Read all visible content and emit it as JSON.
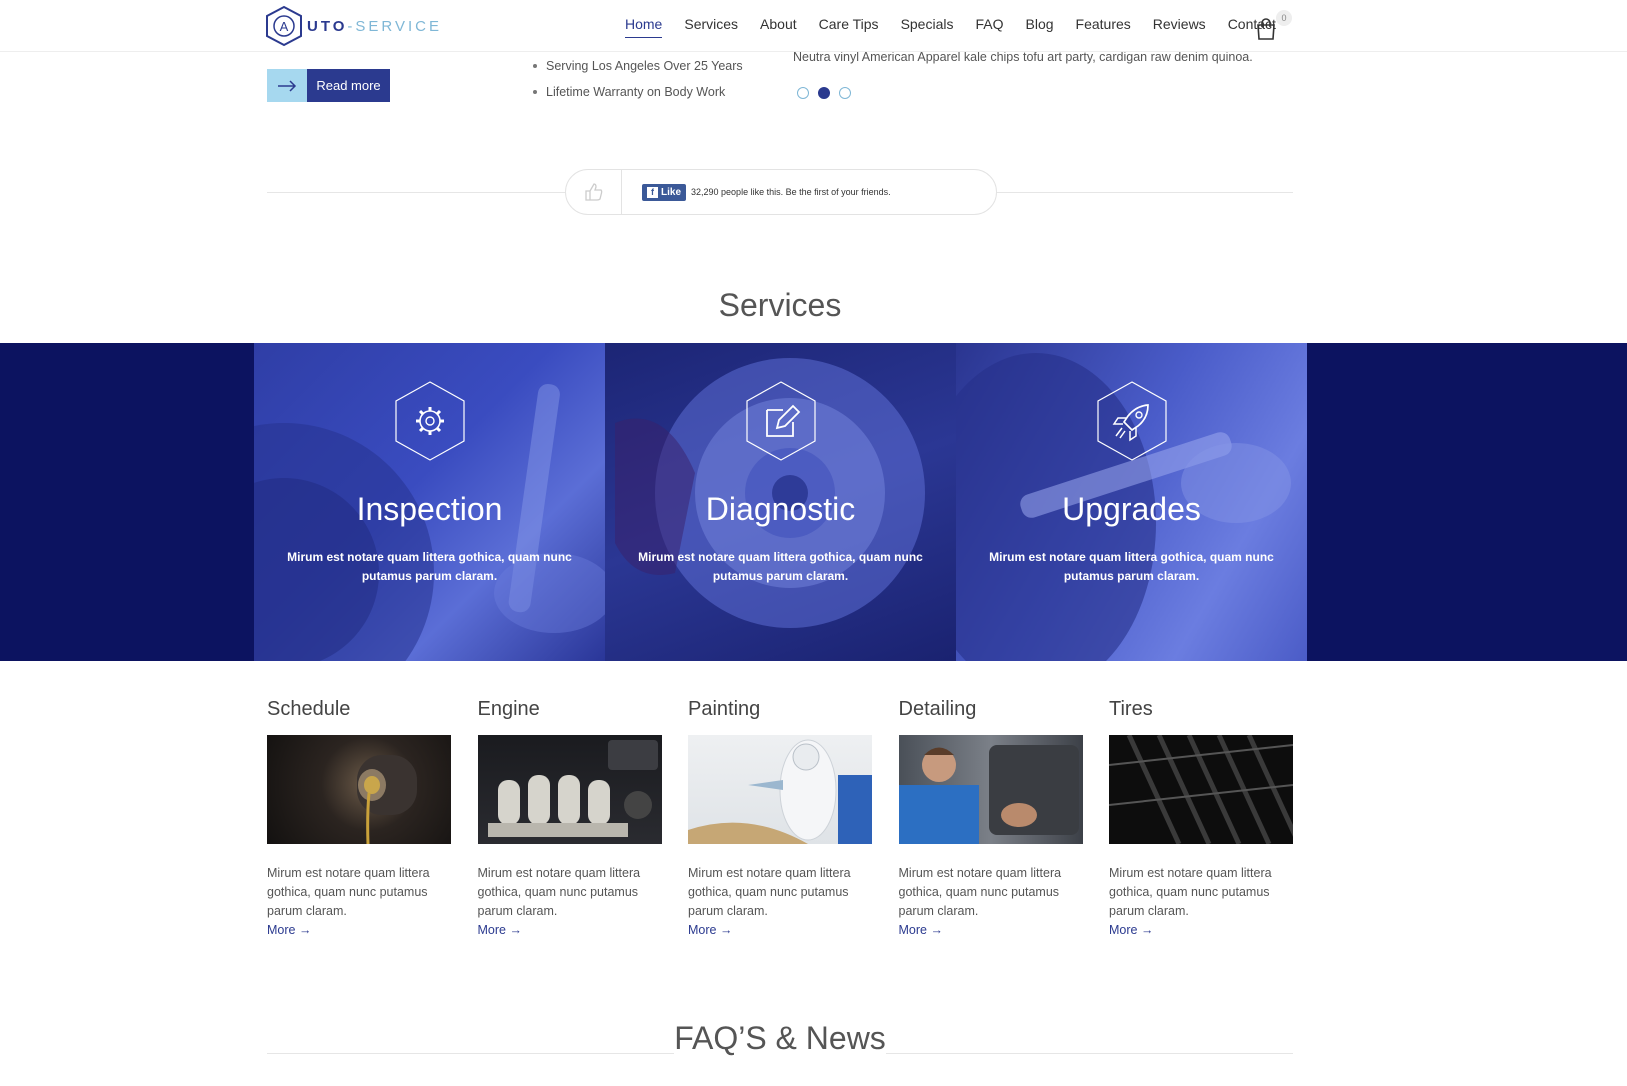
{
  "header": {
    "logo_letter": "A",
    "logo_word_a": "UTO",
    "logo_word_b": "-SERVICE",
    "nav": [
      "Home",
      "Services",
      "About",
      "Care Tips",
      "Specials",
      "FAQ",
      "Blog",
      "Features",
      "Reviews",
      "Contact"
    ],
    "active_nav": "Home",
    "cart_count": "0"
  },
  "intro": {
    "read_more": "Read more",
    "bullets": [
      "Serving Los Angeles Over 25 Years",
      "Lifetime Warranty on Body Work"
    ],
    "tagline": "Neutra vinyl American Apparel kale chips tofu art party, cardigan raw denim quinoa.",
    "slider_active_dot": 2
  },
  "facebook": {
    "like_label": "Like",
    "text": "32,290 people like this. Be the first of your friends."
  },
  "services": {
    "title": "Services",
    "panels": [
      {
        "title": "Inspection",
        "text": "Mirum est notare quam littera gothica, quam nunc putamus parum claram.",
        "icon": "gear-icon"
      },
      {
        "title": "Diagnostic",
        "text": "Mirum est notare quam littera gothica, quam nunc putamus parum claram.",
        "icon": "edit-icon"
      },
      {
        "title": "Upgrades",
        "text": "Mirum est notare quam littera gothica, quam nunc putamus parum claram.",
        "icon": "rocket-icon"
      }
    ]
  },
  "cards": [
    {
      "title": "Schedule",
      "text": "Mirum est notare quam littera gothica, quam nunc putamus parum claram.",
      "more": "More →"
    },
    {
      "title": "Engine",
      "text": "Mirum est notare quam littera gothica, quam nunc putamus parum claram.",
      "more": "More →"
    },
    {
      "title": "Painting",
      "text": "Mirum est notare quam littera gothica, quam nunc putamus parum claram.",
      "more": "More →"
    },
    {
      "title": "Detailing",
      "text": "Mirum est notare quam littera gothica, quam nunc putamus parum claram.",
      "more": "More →"
    },
    {
      "title": "Tires",
      "text": "Mirum est notare quam littera gothica, quam nunc putamus parum claram.",
      "more": "More →"
    }
  ],
  "faq": {
    "title": "FAQ’S & News"
  },
  "colors": {
    "brand": "#2b3a8f",
    "accent": "#a6d8ef",
    "band": "#0c1360"
  }
}
